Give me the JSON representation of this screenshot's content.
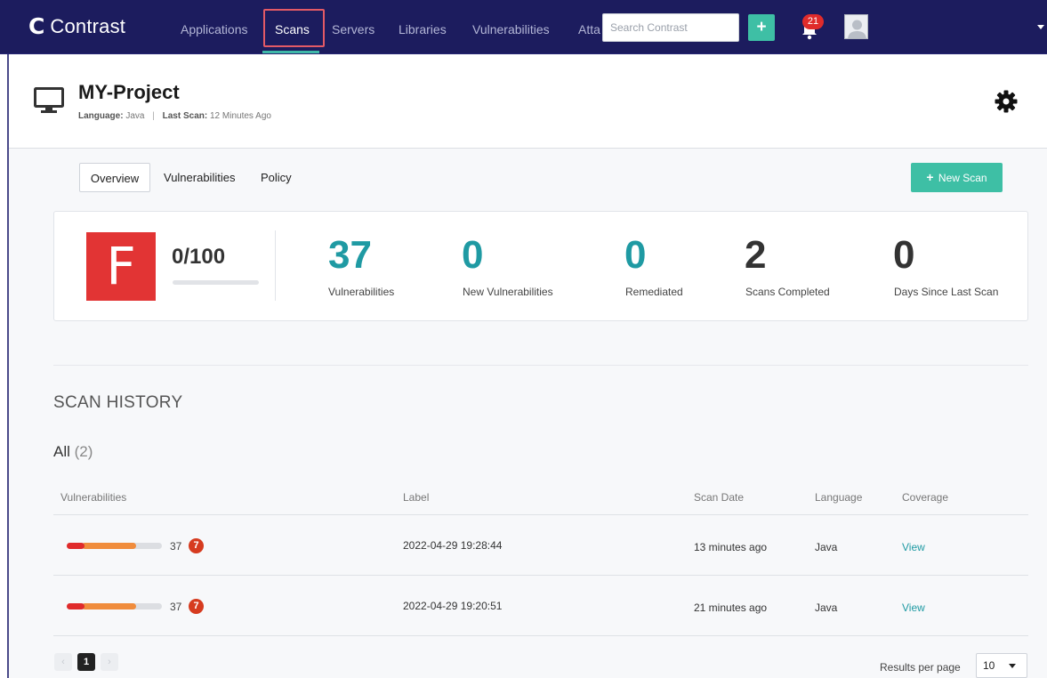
{
  "nav": {
    "brand": "Contrast",
    "items": [
      "Applications",
      "Scans",
      "Servers",
      "Libraries",
      "Vulnerabilities",
      "Atta"
    ],
    "active_item": "Scans",
    "search_placeholder": "Search Contrast",
    "add_label": "+",
    "notification_count": "21",
    "accent_color": "#3ebfa5",
    "bg_color": "#1c1c5e"
  },
  "project": {
    "title": "MY-Project",
    "language_label": "Language:",
    "language": "Java",
    "separator": "|",
    "last_scan_label": "Last Scan:",
    "last_scan": "12 Minutes Ago",
    "settings_icon": "gear-icon",
    "type_icon": "monitor-icon"
  },
  "tabs": [
    "Overview",
    "Vulnerabilities",
    "Policy"
  ],
  "selected_tab": "Overview",
  "new_scan_label": "New Scan",
  "summary": {
    "grade": "F",
    "grade_color": "#e23434",
    "score": "0/100",
    "score_fraction": 0,
    "stats": [
      {
        "value": "37",
        "label": "Vulnerabilities"
      },
      {
        "value": "0",
        "label": "New Vulnerabilities"
      },
      {
        "value": "0",
        "label": "Remediated"
      },
      {
        "value": "2",
        "label": "Scans Completed"
      },
      {
        "value": "0",
        "label": "Days Since Last Scan"
      }
    ]
  },
  "scan_history": {
    "title": "SCAN HISTORY",
    "filter_label": "All",
    "filter_count": "(2)",
    "columns": [
      "Vulnerabilities",
      "Label",
      "Scan Date",
      "Language",
      "Coverage"
    ],
    "rows": [
      {
        "vuln_count": "37",
        "badge": "7",
        "label": "2022-04-29 19:28:44",
        "scan_date": "13 minutes ago",
        "language": "Java",
        "coverage": "View"
      },
      {
        "vuln_count": "37",
        "badge": "7",
        "label": "2022-04-29 19:20:51",
        "scan_date": "21 minutes ago",
        "language": "Java",
        "coverage": "View"
      }
    ]
  },
  "pagination": {
    "prev": "‹",
    "current": "1",
    "next": "›",
    "results_per_page_label": "Results per page",
    "results_per_page": "10"
  }
}
